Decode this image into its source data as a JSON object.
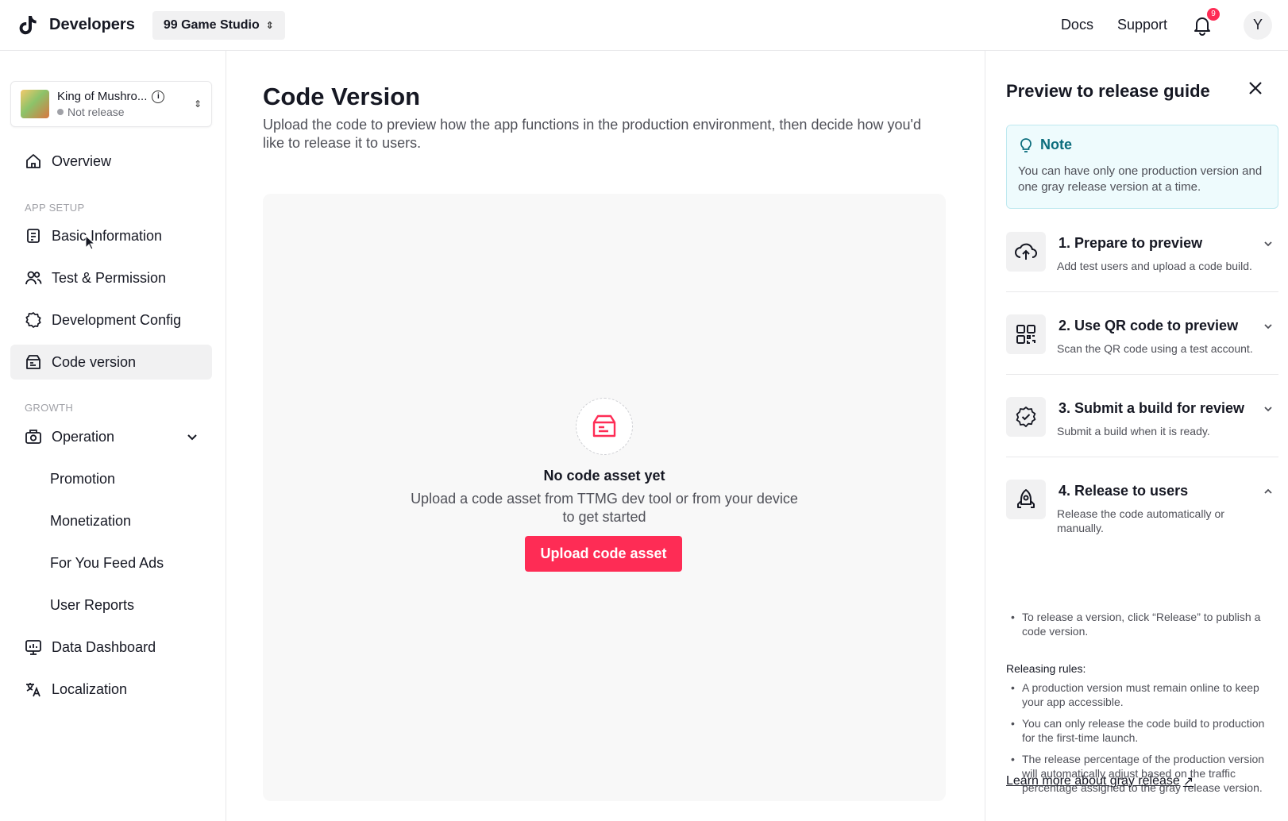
{
  "topbar": {
    "brand": "Developers",
    "studio": "99 Game Studio",
    "docs": "Docs",
    "support": "Support",
    "notification_count": "9",
    "avatar_initial": "Y"
  },
  "app": {
    "name": "King of Mushro...",
    "status": "Not release"
  },
  "sidebar": {
    "overview": "Overview",
    "section_app_setup": "APP SETUP",
    "basic_information": "Basic Information",
    "test_permission": "Test & Permission",
    "development_config": "Development Config",
    "code_version": "Code version",
    "section_growth": "GROWTH",
    "operation": "Operation",
    "promotion": "Promotion",
    "monetization": "Monetization",
    "for_you_feed_ads": "For You Feed Ads",
    "user_reports": "User Reports",
    "data_dashboard": "Data Dashboard",
    "localization": "Localization"
  },
  "main": {
    "title": "Code Version",
    "description": "Upload the code to preview how the app functions in the production environment, then decide how you'd like to release it to users.",
    "empty_title": "No code asset yet",
    "empty_desc": "Upload a code asset from TTMG dev tool or from your device to get started",
    "upload_button": "Upload code asset"
  },
  "panel": {
    "title": "Preview to release guide",
    "note_title": "Note",
    "note_text": "You can have only one production version and one gray release version at a time.",
    "steps": [
      {
        "title": "1. Prepare to preview",
        "sub": "Add test users and upload a code build."
      },
      {
        "title": "2. Use QR code to preview",
        "sub": "Scan the QR code using a test account."
      },
      {
        "title": "3. Submit a build for review",
        "sub": "Submit a build when it is ready."
      },
      {
        "title": "4. Release to users",
        "sub": "Release the code automatically or manually."
      }
    ],
    "release_bullet": "To release a version, click “Release” to publish a code version.",
    "rules_label": "Releasing rules:",
    "rules": [
      "A production version must remain online to keep your app accessible.",
      "You can only release the code build to production for the first-time launch.",
      "The release percentage of the production version will automatically adjust based on the traffic percentage assigned to the gray release version."
    ],
    "learn_more": "Learn more about gray release"
  },
  "colors": {
    "accent": "#fe2c55",
    "note_bg": "#eefbfd",
    "note_title": "#0b6d7d"
  }
}
